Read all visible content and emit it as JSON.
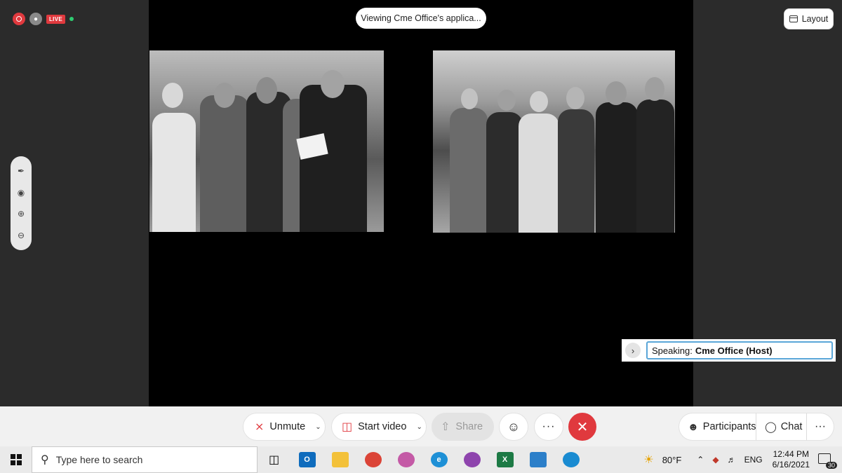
{
  "header": {
    "live_label": "LIVE",
    "viewing_text": "Viewing Cme Office's applica...",
    "layout_label": "Layout"
  },
  "annotation_tools": [
    "pen-icon",
    "laser-pointer-icon",
    "zoom-in-icon",
    "zoom-out-icon"
  ],
  "speaking": {
    "prefix": "Speaking:",
    "name": "Cme Office (Host)"
  },
  "controls": {
    "unmute_label": "Unmute",
    "video_label": "Start video",
    "share_label": "Share",
    "more_label": "···",
    "participants_label": "Participants",
    "chat_label": "Chat"
  },
  "taskbar": {
    "search_placeholder": "Type here to search",
    "weather": "80°F",
    "language": "ENG",
    "time": "12:44 PM",
    "date": "6/16/2021",
    "notification_count": "30"
  },
  "colors": {
    "end_call": "#e0393e",
    "accent_red": "#e0393e",
    "speaking_border": "#5aa6d8"
  }
}
